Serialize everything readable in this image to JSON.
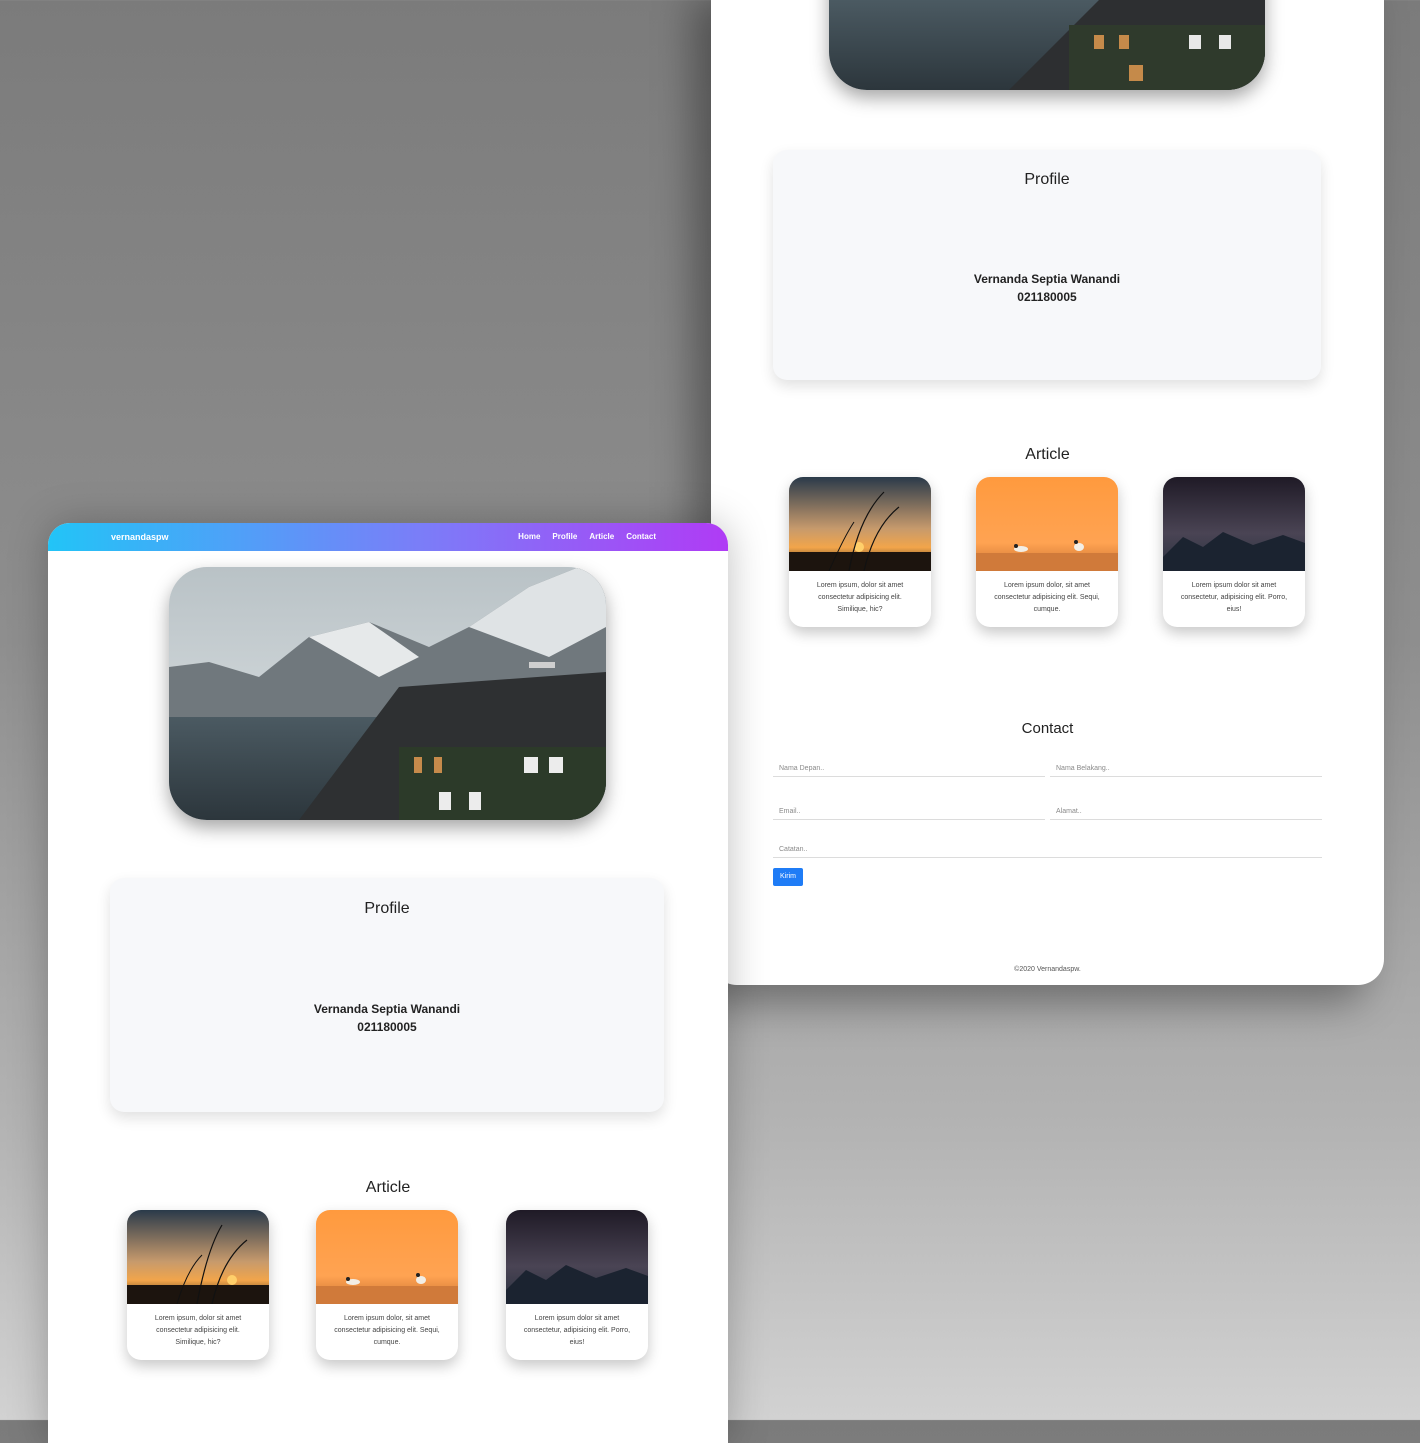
{
  "navbar": {
    "brand": "vernandaspw",
    "links": [
      "Home",
      "Profile",
      "Article",
      "Contact"
    ]
  },
  "profile": {
    "title": "Profile",
    "name": "Vernanda Septia Wanandi",
    "id_number": "021180005"
  },
  "article": {
    "title": "Article",
    "cards": [
      {
        "image": "grass-sunset-photo",
        "text": "Lorem ipsum, dolor sit amet consectetur adipisicing elit. Similique, hic?"
      },
      {
        "image": "birds-orange-photo",
        "text": "Lorem ipsum dolor, sit amet consectetur adipisicing elit. Sequi, cumque."
      },
      {
        "image": "mountain-night-photo",
        "text": "Lorem ipsum dolor sit amet consectetur, adipisicing elit. Porro, eius!"
      }
    ]
  },
  "contact": {
    "title": "Contact",
    "first_name_placeholder": "Nama Depan..",
    "last_name_placeholder": "Nama Belakang..",
    "email_placeholder": "Email..",
    "address_placeholder": "Alamat..",
    "notes_placeholder": "Catatan..",
    "submit_label": "Kirim"
  },
  "footer": {
    "text": "©2020 Vernandaspw."
  },
  "colors": {
    "navbar_gradient_start": "#22c4f7",
    "navbar_gradient_end": "#b03bf5",
    "button": "#1f7cf6",
    "card_bg": "#f7f8fa"
  }
}
